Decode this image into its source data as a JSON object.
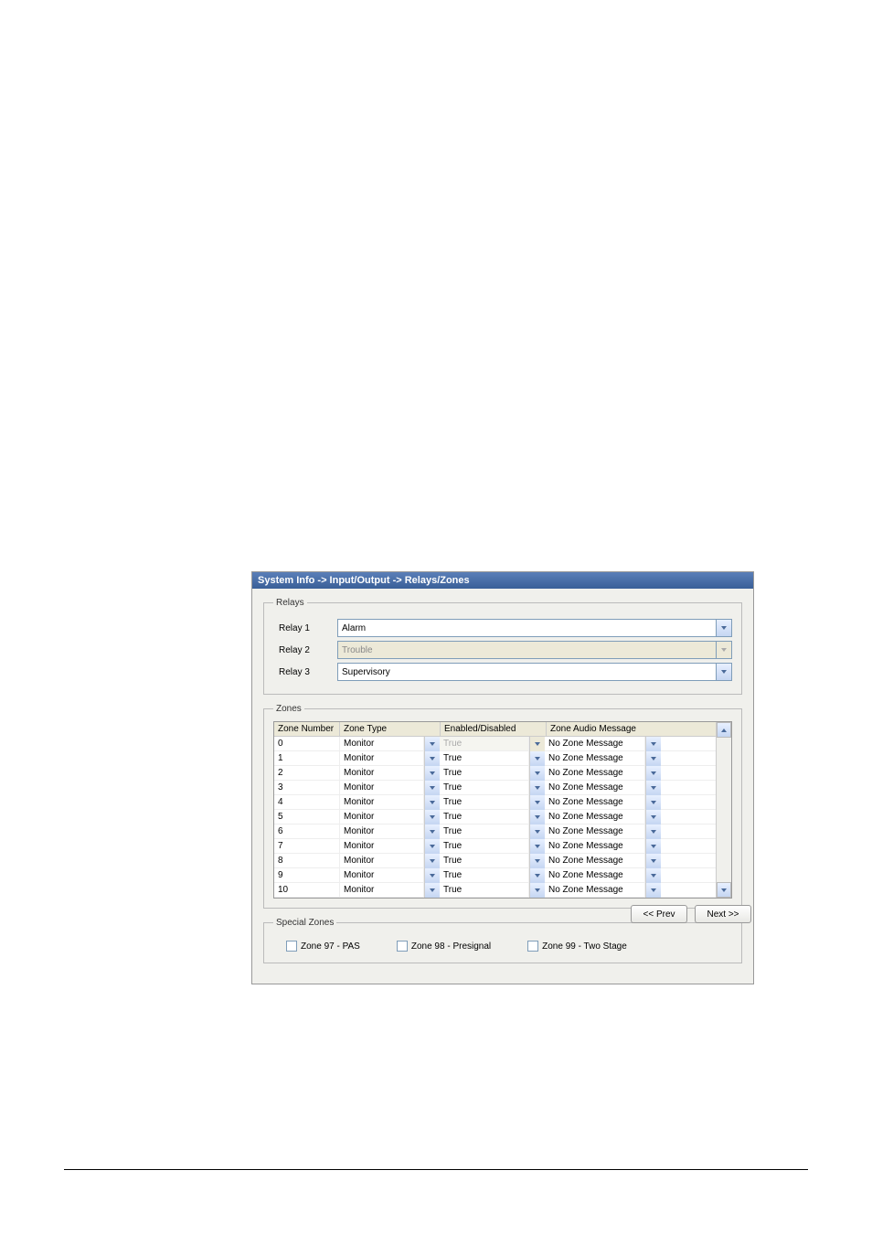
{
  "title": "System Info -> Input/Output -> Relays/Zones",
  "relays": {
    "legend": "Relays",
    "rows": [
      {
        "label": "Relay 1",
        "value": "Alarm",
        "enabled": true
      },
      {
        "label": "Relay 2",
        "value": "Trouble",
        "enabled": false
      },
      {
        "label": "Relay 3",
        "value": "Supervisory",
        "enabled": true
      }
    ]
  },
  "zones": {
    "legend": "Zones",
    "headers": [
      "Zone Number",
      "Zone Type",
      "Enabled/Disabled",
      "Zone Audio Message"
    ],
    "rows": [
      {
        "num": "0",
        "type": "Monitor",
        "enabled": "True",
        "enabled_editable": false,
        "audio": "No Zone Message"
      },
      {
        "num": "1",
        "type": "Monitor",
        "enabled": "True",
        "enabled_editable": true,
        "audio": "No Zone Message"
      },
      {
        "num": "2",
        "type": "Monitor",
        "enabled": "True",
        "enabled_editable": true,
        "audio": "No Zone Message"
      },
      {
        "num": "3",
        "type": "Monitor",
        "enabled": "True",
        "enabled_editable": true,
        "audio": "No Zone Message"
      },
      {
        "num": "4",
        "type": "Monitor",
        "enabled": "True",
        "enabled_editable": true,
        "audio": "No Zone Message"
      },
      {
        "num": "5",
        "type": "Monitor",
        "enabled": "True",
        "enabled_editable": true,
        "audio": "No Zone Message"
      },
      {
        "num": "6",
        "type": "Monitor",
        "enabled": "True",
        "enabled_editable": true,
        "audio": "No Zone Message"
      },
      {
        "num": "7",
        "type": "Monitor",
        "enabled": "True",
        "enabled_editable": true,
        "audio": "No Zone Message"
      },
      {
        "num": "8",
        "type": "Monitor",
        "enabled": "True",
        "enabled_editable": true,
        "audio": "No Zone Message"
      },
      {
        "num": "9",
        "type": "Monitor",
        "enabled": "True",
        "enabled_editable": true,
        "audio": "No Zone Message"
      },
      {
        "num": "10",
        "type": "Monitor",
        "enabled": "True",
        "enabled_editable": true,
        "audio": "No Zone Message"
      }
    ]
  },
  "special": {
    "legend": "Special Zones",
    "items": [
      {
        "label": "Zone 97 - PAS"
      },
      {
        "label": "Zone 98 - Presignal"
      },
      {
        "label": "Zone 99 - Two Stage"
      }
    ]
  },
  "nav": {
    "prev": "<< Prev",
    "next": "Next >>"
  }
}
